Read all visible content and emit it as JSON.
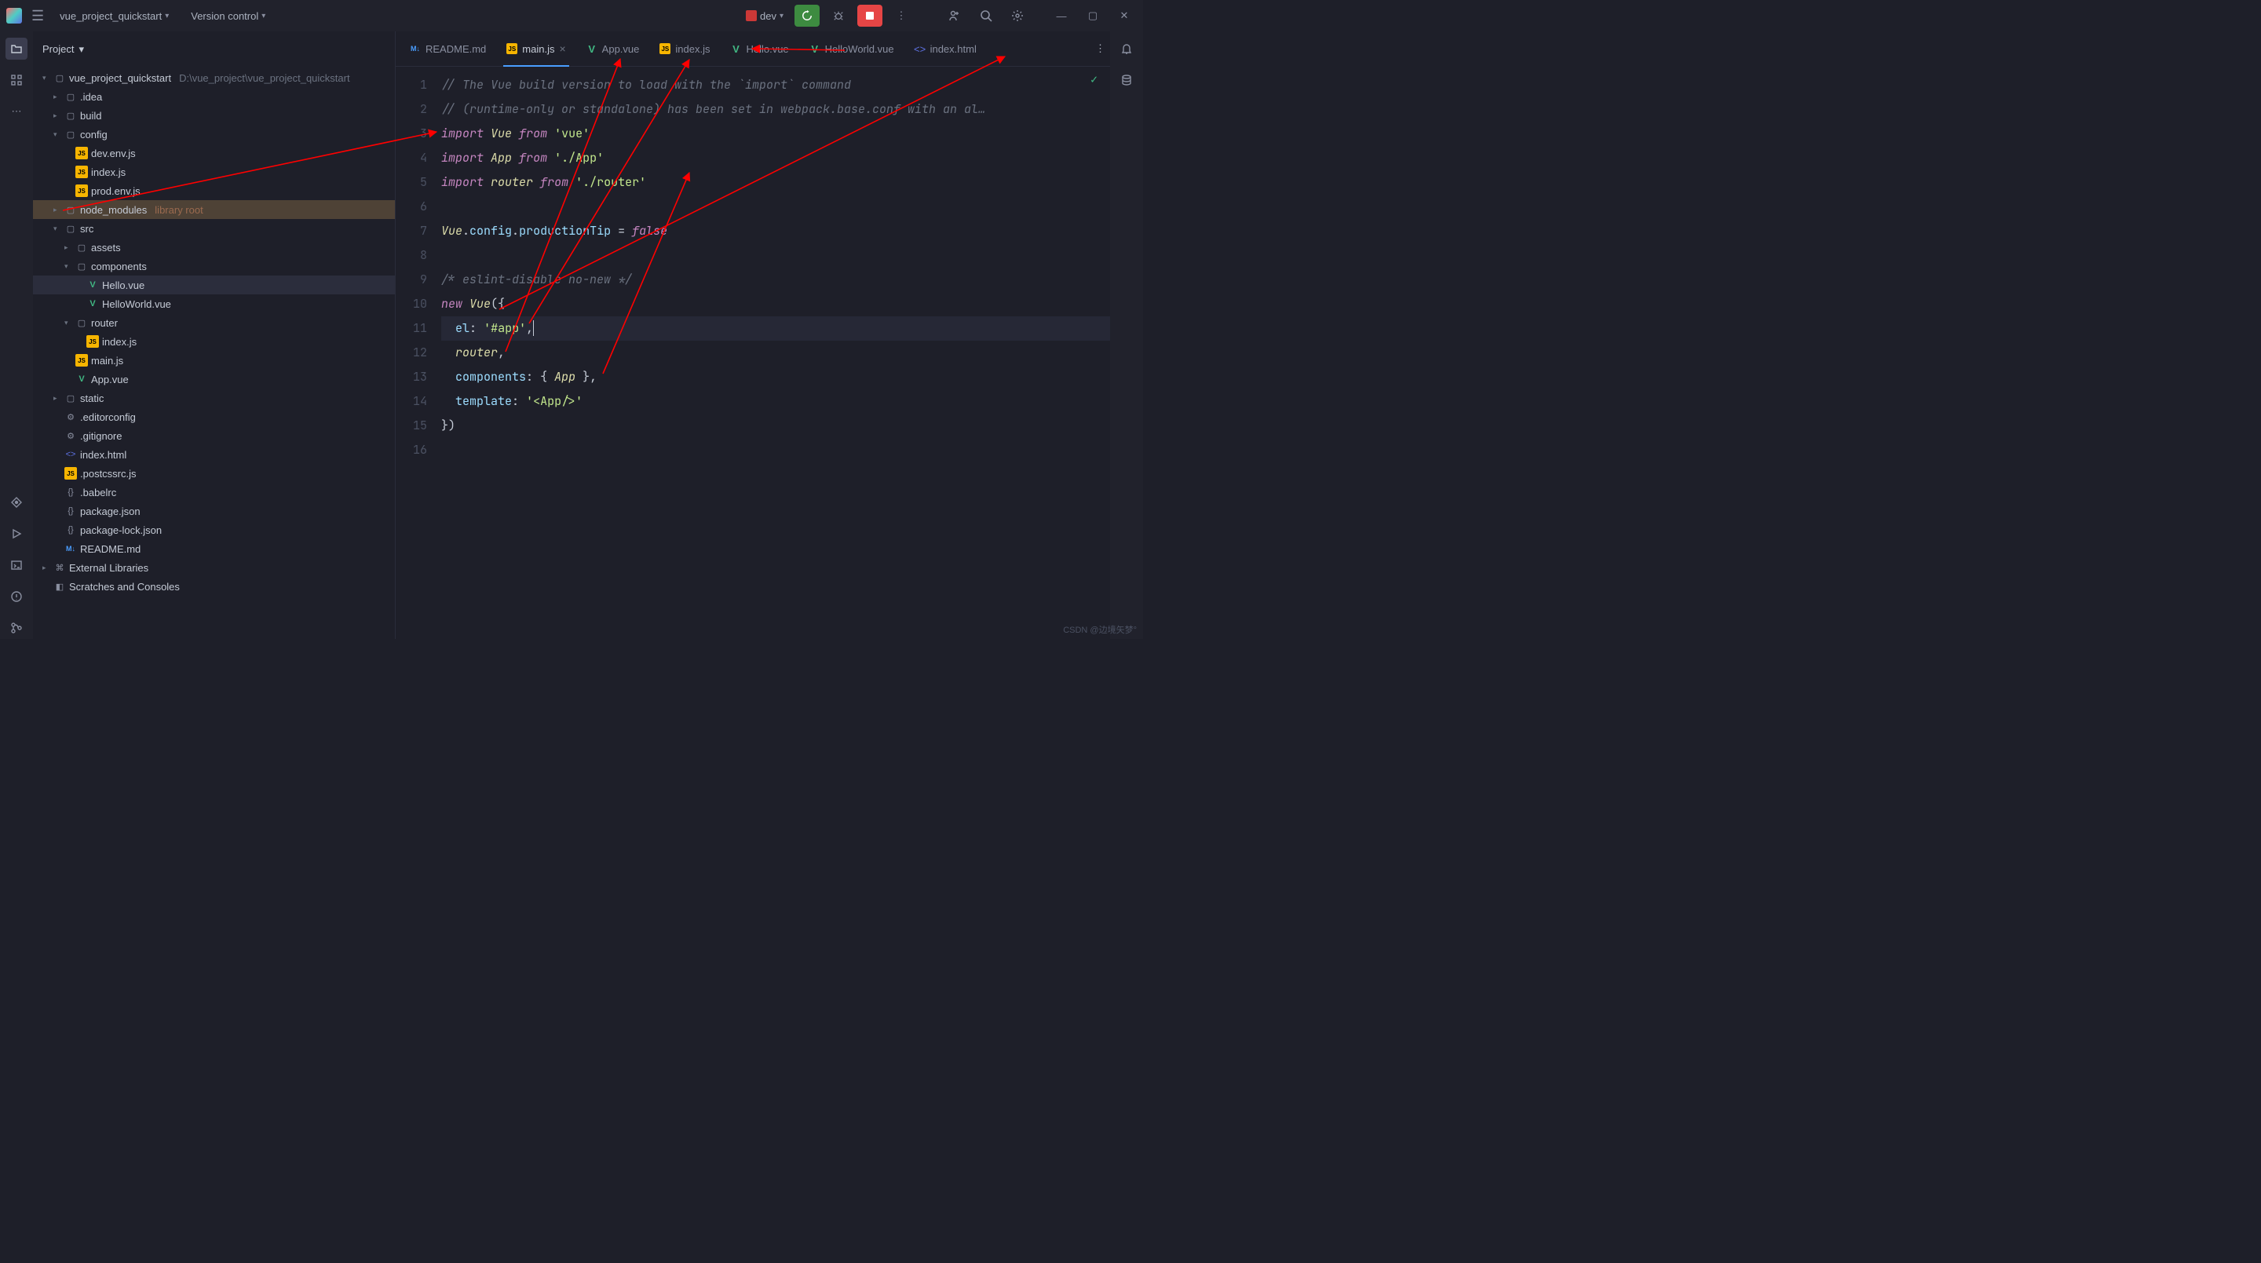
{
  "titlebar": {
    "project_name": "vue_project_quickstart",
    "vcs_label": "Version control",
    "run_config": "dev"
  },
  "projectPanel": {
    "header": "Project",
    "root": {
      "name": "vue_project_quickstart",
      "path": "D:\\vue_project\\vue_project_quickstart"
    },
    "tree": [
      {
        "name": ".idea",
        "type": "folder",
        "indent": 1,
        "closed": true
      },
      {
        "name": "build",
        "type": "folder",
        "indent": 1,
        "closed": true
      },
      {
        "name": "config",
        "type": "folder",
        "indent": 1,
        "open": true
      },
      {
        "name": "dev.env.js",
        "type": "js",
        "indent": 2
      },
      {
        "name": "index.js",
        "type": "js",
        "indent": 2
      },
      {
        "name": "prod.env.js",
        "type": "js",
        "indent": 2
      },
      {
        "name": "node_modules",
        "type": "folder",
        "indent": 1,
        "closed": true,
        "libroot": "library root",
        "hl": true
      },
      {
        "name": "src",
        "type": "folder",
        "indent": 1,
        "open": true
      },
      {
        "name": "assets",
        "type": "folder",
        "indent": 2,
        "closed": true
      },
      {
        "name": "components",
        "type": "folder",
        "indent": 2,
        "open": true
      },
      {
        "name": "Hello.vue",
        "type": "vue",
        "indent": 3,
        "active": true
      },
      {
        "name": "HelloWorld.vue",
        "type": "vue",
        "indent": 3
      },
      {
        "name": "router",
        "type": "folder",
        "indent": 2,
        "open": true
      },
      {
        "name": "index.js",
        "type": "js",
        "indent": 3
      },
      {
        "name": "main.js",
        "type": "js",
        "indent": 2
      },
      {
        "name": "App.vue",
        "type": "vue",
        "indent": 2
      },
      {
        "name": "static",
        "type": "folder",
        "indent": 1,
        "closed": true
      },
      {
        "name": ".editorconfig",
        "type": "cfg",
        "indent": 1
      },
      {
        "name": ".gitignore",
        "type": "cfg",
        "indent": 1
      },
      {
        "name": "index.html",
        "type": "html",
        "indent": 1
      },
      {
        "name": ".postcssrc.js",
        "type": "js",
        "indent": 1
      },
      {
        "name": ".babelrc",
        "type": "json",
        "indent": 1
      },
      {
        "name": "package.json",
        "type": "json",
        "indent": 1
      },
      {
        "name": "package-lock.json",
        "type": "json",
        "indent": 1
      },
      {
        "name": "README.md",
        "type": "md",
        "indent": 1
      }
    ],
    "ext_libs": "External Libraries",
    "scratches": "Scratches and Consoles"
  },
  "tabs": [
    {
      "name": "README.md",
      "type": "md"
    },
    {
      "name": "main.js",
      "type": "js",
      "active": true,
      "closable": true
    },
    {
      "name": "App.vue",
      "type": "vue"
    },
    {
      "name": "index.js",
      "type": "js"
    },
    {
      "name": "Hello.vue",
      "type": "vue"
    },
    {
      "name": "HelloWorld.vue",
      "type": "vue"
    },
    {
      "name": "index.html",
      "type": "html"
    }
  ],
  "editor": {
    "lines": [
      {
        "n": 1,
        "html": "<span class=\"c-comment\">// The Vue build version to load with the `import` command</span>"
      },
      {
        "n": 2,
        "html": "<span class=\"c-comment\">// (runtime-only or standalone) has been set in webpack.base.conf with an al…</span>"
      },
      {
        "n": 3,
        "html": "<span class=\"c-kw\">import</span> <span class=\"c-ident\">Vue</span> <span class=\"c-kw\">from</span> <span class=\"c-str\">'vue'</span>"
      },
      {
        "n": 4,
        "html": "<span class=\"c-kw\">import</span> <span class=\"c-ident\">App</span> <span class=\"c-kw\">from</span> <span class=\"c-str\">'./App'</span>"
      },
      {
        "n": 5,
        "html": "<span class=\"c-kw\">import</span> <span class=\"c-ident\">router</span> <span class=\"c-kw\">from</span> <span class=\"c-str\">'./router'</span>"
      },
      {
        "n": 6,
        "html": ""
      },
      {
        "n": 7,
        "html": "<span class=\"c-ident\">Vue</span><span class=\"c-punc\">.</span><span class=\"c-prop\">config</span><span class=\"c-punc\">.</span><span class=\"c-prop\">productionTip</span> <span class=\"c-punc\">=</span> <span class=\"c-kw\">false</span>"
      },
      {
        "n": 8,
        "html": ""
      },
      {
        "n": 9,
        "html": "<span class=\"c-comment\">/* eslint-disable no-new */</span>"
      },
      {
        "n": 10,
        "html": "<span class=\"c-kw\">new</span> <span class=\"c-ident\">Vue</span><span class=\"c-punc\">({</span>"
      },
      {
        "n": 11,
        "html": "  <span class=\"c-prop\">el</span><span class=\"c-punc\">:</span> <span class=\"c-str\">'#app'</span><span class=\"c-punc\">,</span><span class=\"cursor\"></span>",
        "current": true
      },
      {
        "n": 12,
        "html": "  <span class=\"c-ident\">router</span><span class=\"c-punc\">,</span>"
      },
      {
        "n": 13,
        "html": "  <span class=\"c-prop\">components</span><span class=\"c-punc\">:</span> <span class=\"c-punc\">{</span> <span class=\"c-ident\">App</span> <span class=\"c-punc\">},</span>"
      },
      {
        "n": 14,
        "html": "  <span class=\"c-prop\">template</span><span class=\"c-punc\">:</span> <span class=\"c-str\">'&lt;App/&gt;'</span>"
      },
      {
        "n": 15,
        "html": "<span class=\"c-punc\">})</span>"
      },
      {
        "n": 16,
        "html": ""
      }
    ]
  },
  "watermark": "CSDN @边境矢梦°"
}
